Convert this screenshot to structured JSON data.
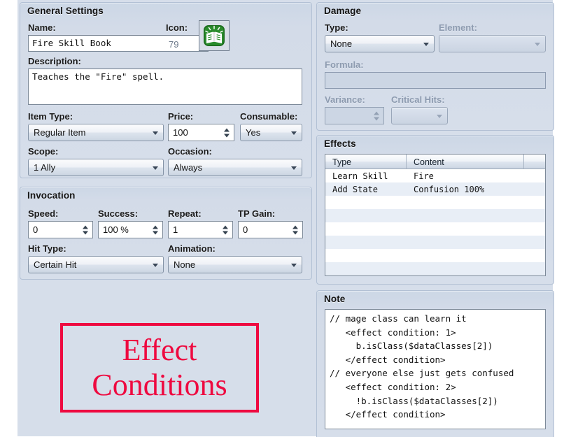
{
  "general": {
    "title": "General Settings",
    "name_label": "Name:",
    "name_value": "Fire Skill Book",
    "icon_label": "Icon:",
    "icon_index": "79",
    "icon_glyph": "book-icon",
    "description_label": "Description:",
    "description_value": "Teaches the \"Fire\" spell.",
    "item_type_label": "Item Type:",
    "item_type_value": "Regular Item",
    "price_label": "Price:",
    "price_value": "100",
    "consumable_label": "Consumable:",
    "consumable_value": "Yes",
    "scope_label": "Scope:",
    "scope_value": "1 Ally",
    "occasion_label": "Occasion:",
    "occasion_value": "Always"
  },
  "invocation": {
    "title": "Invocation",
    "speed_label": "Speed:",
    "speed_value": "0",
    "success_label": "Success:",
    "success_value": "100 %",
    "repeat_label": "Repeat:",
    "repeat_value": "1",
    "tp_gain_label": "TP Gain:",
    "tp_gain_value": "0",
    "hit_type_label": "Hit Type:",
    "hit_type_value": "Certain Hit",
    "animation_label": "Animation:",
    "animation_value": "None"
  },
  "damage": {
    "title": "Damage",
    "type_label": "Type:",
    "type_value": "None",
    "element_label": "Element:",
    "element_value": "",
    "formula_label": "Formula:",
    "formula_value": "",
    "variance_label": "Variance:",
    "variance_value": "",
    "critical_label": "Critical Hits:",
    "critical_value": ""
  },
  "effects": {
    "title": "Effects",
    "columns": [
      "Type",
      "Content",
      ""
    ],
    "rows": [
      {
        "type": "Learn Skill",
        "content": "Fire"
      },
      {
        "type": "Add State",
        "content": "Confusion 100%"
      }
    ],
    "empty_row_count": 8
  },
  "note": {
    "title": "Note",
    "text": "// mage class can learn it\n   <effect condition: 1>\n     b.isClass($dataClasses[2])\n   </effect condition>\n// everyone else just gets confused\n   <effect condition: 2>\n     !b.isClass($dataClasses[2])\n   </effect condition>"
  },
  "annotation": {
    "line1": "Effect",
    "line2": "Conditions",
    "color": "#ee0a40"
  }
}
